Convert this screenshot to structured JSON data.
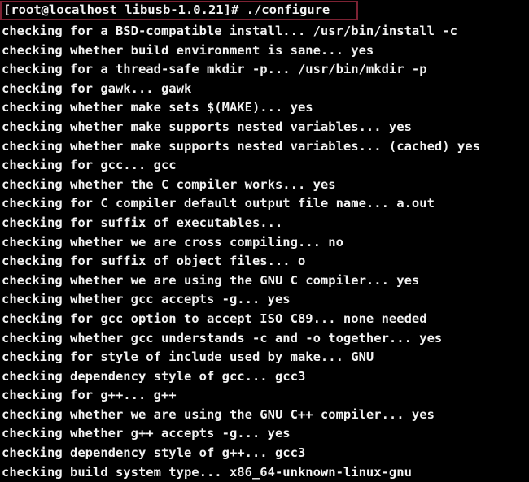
{
  "terminal": {
    "window_kind": "linux-terminal",
    "background_color": "#000000",
    "foreground_color": "#f2f2f2",
    "prompt": {
      "user": "root",
      "host": "localhost",
      "cwd": "libusb-1.0.21",
      "symbol": "#",
      "command": "./configure",
      "full_text": "[root@localhost libusb-1.0.21]# ./configure"
    },
    "annotation": {
      "type": "highlight-rectangle",
      "color": "#7c2233",
      "target": "prompt-command-line"
    },
    "output_lines": [
      "checking for a BSD-compatible install... /usr/bin/install -c",
      "checking whether build environment is sane... yes",
      "checking for a thread-safe mkdir -p... /usr/bin/mkdir -p",
      "checking for gawk... gawk",
      "checking whether make sets $(MAKE)... yes",
      "checking whether make supports nested variables... yes",
      "checking whether make supports nested variables... (cached) yes",
      "checking for gcc... gcc",
      "checking whether the C compiler works... yes",
      "checking for C compiler default output file name... a.out",
      "checking for suffix of executables...",
      "checking whether we are cross compiling... no",
      "checking for suffix of object files... o",
      "checking whether we are using the GNU C compiler... yes",
      "checking whether gcc accepts -g... yes",
      "checking for gcc option to accept ISO C89... none needed",
      "checking whether gcc understands -c and -o together... yes",
      "checking for style of include used by make... GNU",
      "checking dependency style of gcc... gcc3",
      "checking for g++... g++",
      "checking whether we are using the GNU C++ compiler... yes",
      "checking whether g++ accepts -g... yes",
      "checking dependency style of g++... gcc3",
      "checking build system type... x86_64-unknown-linux-gnu"
    ]
  }
}
